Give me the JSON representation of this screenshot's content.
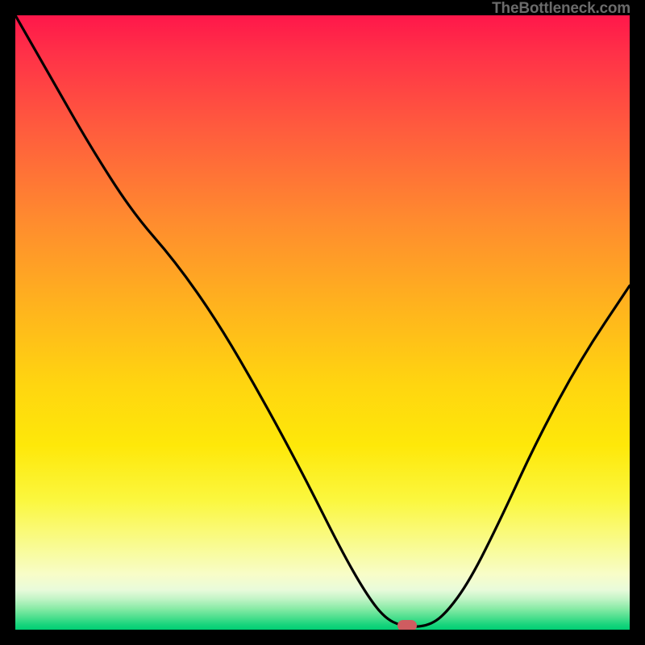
{
  "attribution": "TheBottleneck.com",
  "marker": {
    "cx_frac": 0.638,
    "cy_frac": 0.994
  },
  "chart_data": {
    "type": "line",
    "title": "",
    "xlabel": "",
    "ylabel": "",
    "xlim": [
      0,
      1
    ],
    "ylim": [
      0,
      1
    ],
    "series": [
      {
        "name": "curve",
        "x": [
          0.0,
          0.06,
          0.12,
          0.19,
          0.26,
          0.33,
          0.4,
          0.47,
          0.53,
          0.57,
          0.6,
          0.63,
          0.67,
          0.7,
          0.74,
          0.79,
          0.85,
          0.92,
          1.0
        ],
        "y": [
          1.0,
          0.895,
          0.79,
          0.68,
          0.6,
          0.5,
          0.38,
          0.25,
          0.13,
          0.06,
          0.02,
          0.005,
          0.005,
          0.025,
          0.08,
          0.18,
          0.31,
          0.44,
          0.56
        ]
      }
    ],
    "gradient_stops": [
      {
        "pos": 0.0,
        "color": "#ff174a"
      },
      {
        "pos": 0.06,
        "color": "#ff3048"
      },
      {
        "pos": 0.18,
        "color": "#ff5a3e"
      },
      {
        "pos": 0.33,
        "color": "#ff8a2f"
      },
      {
        "pos": 0.47,
        "color": "#ffb21e"
      },
      {
        "pos": 0.6,
        "color": "#ffd510"
      },
      {
        "pos": 0.7,
        "color": "#fee809"
      },
      {
        "pos": 0.79,
        "color": "#fbf73f"
      },
      {
        "pos": 0.86,
        "color": "#f9fb8e"
      },
      {
        "pos": 0.91,
        "color": "#f8fdc8"
      },
      {
        "pos": 0.935,
        "color": "#e9fbdb"
      },
      {
        "pos": 0.95,
        "color": "#c1f4c6"
      },
      {
        "pos": 0.965,
        "color": "#8beba7"
      },
      {
        "pos": 0.98,
        "color": "#4cdf8e"
      },
      {
        "pos": 0.992,
        "color": "#17d47c"
      },
      {
        "pos": 1.0,
        "color": "#00cf74"
      }
    ],
    "background_frame_color": "#000000",
    "marker_color": "#cf5c60"
  }
}
